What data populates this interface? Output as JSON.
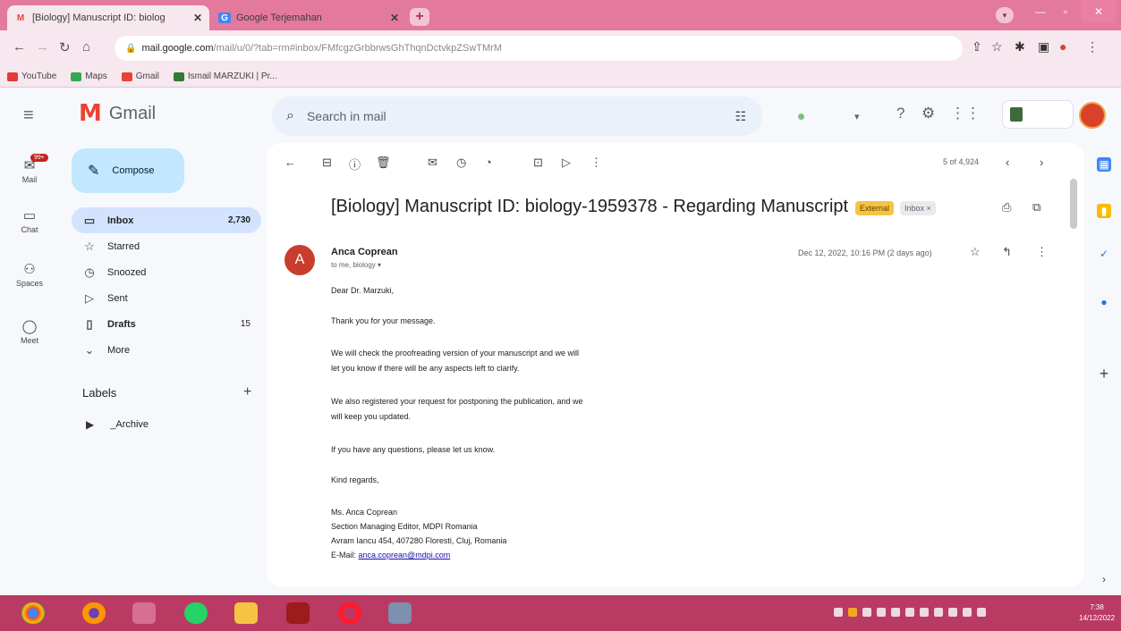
{
  "browser": {
    "tabs": [
      {
        "favicon": "M",
        "title": "[Biology] Manuscript ID: biolog",
        "close": "✕"
      },
      {
        "favicon": "G",
        "title": "Google Terjemahan",
        "close": "✕"
      }
    ],
    "new_tab": "+",
    "url_host": "mail.google.com",
    "url_rest": "/mail/u/0/?tab=rm#inbox/FMfcgzGrbbrwsGhThqnDctvkpZSwTMrM",
    "bookmarks": [
      {
        "label": "YouTube",
        "color": "#e53935"
      },
      {
        "label": "Maps",
        "color": "#34a853"
      },
      {
        "label": "Gmail",
        "color": "#ea4335"
      },
      {
        "label": "Ismail MARZUKI | Pr...",
        "color": "#2e7d32"
      }
    ]
  },
  "gmail": {
    "logo_text": "Gmail",
    "search_placeholder": "Search in mail",
    "compose_label": "Compose",
    "rail": [
      {
        "label": "Mail",
        "badge": "99+"
      },
      {
        "label": "Chat"
      },
      {
        "label": "Spaces"
      },
      {
        "label": "Meet"
      }
    ],
    "folders": [
      {
        "label": "Inbox",
        "count": "2,730"
      },
      {
        "label": "Starred",
        "count": ""
      },
      {
        "label": "Snoozed",
        "count": ""
      },
      {
        "label": "Sent",
        "count": ""
      },
      {
        "label": "Drafts",
        "count": "15"
      },
      {
        "label": "More",
        "count": ""
      }
    ],
    "labels_heading": "Labels",
    "labels": [
      {
        "label": "_Archive"
      }
    ],
    "pager": "5 of 4,924",
    "message": {
      "subject": "[Biology] Manuscript ID: biology-1959378 - Regarding Manuscript",
      "tag_external": "External",
      "tag_inbox": "Inbox ×",
      "sender_initial": "A",
      "sender_name": "Anca Coprean",
      "recipients": "to me, biology ▾",
      "date": "Dec 12, 2022, 10:16 PM (2 days ago)",
      "body": [
        "Dear Dr. Marzuki,",
        "Thank you for your message.",
        "We will check the proofreading version of your manuscript and we will",
        "let you know if there will be any aspects left to clarify.",
        "We also registered your request for postponing the publication, and we",
        "will keep you updated.",
        "If you have any questions, please let us know.",
        "Kind regards,",
        "Ms. Anca Coprean",
        "Section Managing Editor, MDPI Romania",
        "Avram Iancu 454, 407280 Floresti, Cluj, Romania"
      ],
      "email_label": "E-Mail: ",
      "email_link": "anca.coprean@mdpi.com"
    }
  },
  "taskbar": {
    "time": "7:38",
    "date": "14/12/2022"
  }
}
